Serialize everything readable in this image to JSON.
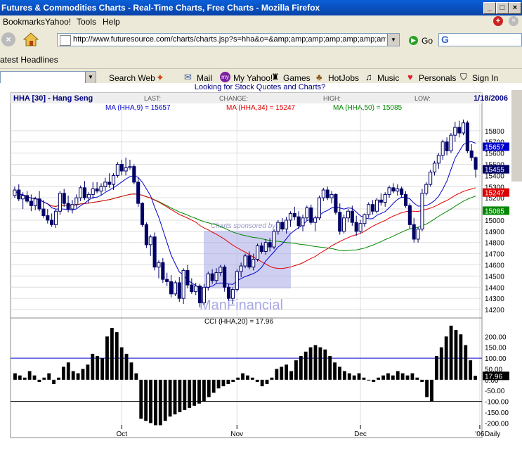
{
  "window": {
    "title": "Futures & Commodities Charts - Real-Time Charts, Free Charts - Mozilla Firefox"
  },
  "menu": [
    "Bookmarks",
    "Yahoo!",
    "Tools",
    "Help"
  ],
  "nav": {
    "url": "http://www.futuresource.com/charts/charts.jsp?s=hha&o=&amp;amp;amp;amp;amp;amp;amp;amp;a=",
    "go_label": "Go"
  },
  "headlines_label": "atest Headlines",
  "yahoo_toolbar": {
    "items": [
      "Search Web",
      "Mail",
      "My Yahoo!",
      "Games",
      "HotJobs",
      "Music",
      "Personals",
      "Sign In"
    ]
  },
  "page": {
    "looking_for": "Looking for Stock Quotes and Charts?"
  },
  "chart_data": {
    "type": "candlestick",
    "title": "HHA [30] - Hang Seng",
    "date": "1/18/2006",
    "header_fields": [
      "LAST:",
      "CHANGE:",
      "HIGH:",
      "LOW:"
    ],
    "ma_labels": [
      {
        "text": "MA (HHA,9) = 15657",
        "color": "#0000cc",
        "value": 15657
      },
      {
        "text": "MA (HHA,34) = 15247",
        "color": "#dd0000",
        "value": 15247
      },
      {
        "text": "MA (HHA,50) = 15085",
        "color": "#008800",
        "value": 15085
      }
    ],
    "last_price": 15455,
    "ylim": [
      14150,
      15950
    ],
    "y_ticks": [
      15800,
      15700,
      15600,
      15500,
      15400,
      15300,
      15200,
      15100,
      15000,
      14900,
      14800,
      14700,
      14600,
      14500,
      14400,
      14300,
      14200
    ],
    "x_ticks": [
      {
        "label": "Oct",
        "index": 26
      },
      {
        "label": "Nov",
        "index": 54
      },
      {
        "label": "Dec",
        "index": 84
      },
      {
        "label": "'06",
        "index": 113
      }
    ],
    "watermark": {
      "sponsor": "Charts sponsored by:",
      "brand": "ManFinancial"
    },
    "candles": [
      [
        15220,
        15300,
        15200,
        15270
      ],
      [
        15270,
        15320,
        15170,
        15190
      ],
      [
        15190,
        15250,
        15100,
        15220
      ],
      [
        15220,
        15260,
        15150,
        15170
      ],
      [
        15170,
        15230,
        15080,
        15130
      ],
      [
        15130,
        15210,
        15090,
        15190
      ],
      [
        15190,
        15260,
        15080,
        15100
      ],
      [
        15100,
        15180,
        15020,
        15040
      ],
      [
        15040,
        15100,
        14970,
        15000
      ],
      [
        15000,
        15060,
        14940,
        14960
      ],
      [
        14960,
        15100,
        14930,
        15080
      ],
      [
        15080,
        15260,
        15050,
        15240
      ],
      [
        15240,
        15280,
        15120,
        15150
      ],
      [
        15150,
        15220,
        15070,
        15100
      ],
      [
        15100,
        15180,
        15060,
        15140
      ],
      [
        15140,
        15230,
        15110,
        15200
      ],
      [
        15200,
        15310,
        15170,
        15290
      ],
      [
        15290,
        15350,
        15180,
        15200
      ],
      [
        15200,
        15250,
        15150,
        15230
      ],
      [
        15230,
        15340,
        15190,
        15280
      ],
      [
        15280,
        15340,
        15240,
        15260
      ],
      [
        15260,
        15330,
        15220,
        15300
      ],
      [
        15300,
        15380,
        15260,
        15340
      ],
      [
        15340,
        15420,
        15290,
        15320
      ],
      [
        15320,
        15420,
        15270,
        15400
      ],
      [
        15400,
        15520,
        15380,
        15500
      ],
      [
        15500,
        15540,
        15400,
        15440
      ],
      [
        15440,
        15560,
        15400,
        15470
      ],
      [
        15470,
        15540,
        15450,
        15480
      ],
      [
        15480,
        15500,
        15320,
        15340
      ],
      [
        15340,
        15380,
        15120,
        15150
      ],
      [
        15150,
        15160,
        14940,
        14960
      ],
      [
        14960,
        14980,
        14750,
        14780
      ],
      [
        14780,
        14870,
        14680,
        14850
      ],
      [
        14850,
        14890,
        14550,
        14580
      ],
      [
        14580,
        14640,
        14480,
        14620
      ],
      [
        14620,
        14660,
        14440,
        14470
      ],
      [
        14470,
        14530,
        14410,
        14450
      ],
      [
        14450,
        14510,
        14310,
        14340
      ],
      [
        14340,
        14460,
        14320,
        14440
      ],
      [
        14440,
        14490,
        14270,
        14300
      ],
      [
        14300,
        14570,
        14250,
        14550
      ],
      [
        14550,
        14600,
        14390,
        14420
      ],
      [
        14420,
        14480,
        14340,
        14360
      ],
      [
        14360,
        14440,
        14330,
        14410
      ],
      [
        14410,
        14430,
        14220,
        14260
      ],
      [
        14260,
        14430,
        14240,
        14400
      ],
      [
        14400,
        14540,
        14370,
        14520
      ],
      [
        14520,
        14560,
        14430,
        14460
      ],
      [
        14460,
        14570,
        14430,
        14530
      ],
      [
        14530,
        14600,
        14500,
        14580
      ],
      [
        14580,
        14600,
        14360,
        14400
      ],
      [
        14400,
        14430,
        14280,
        14300
      ],
      [
        14300,
        14400,
        14250,
        14380
      ],
      [
        14380,
        14560,
        14360,
        14540
      ],
      [
        14540,
        14620,
        14490,
        14590
      ],
      [
        14590,
        14700,
        14570,
        14680
      ],
      [
        14680,
        14720,
        14560,
        14580
      ],
      [
        14580,
        14700,
        14550,
        14650
      ],
      [
        14650,
        14790,
        14630,
        14770
      ],
      [
        14770,
        14800,
        14700,
        14720
      ],
      [
        14720,
        14830,
        14690,
        14800
      ],
      [
        14800,
        14840,
        14720,
        14760
      ],
      [
        14760,
        14920,
        14740,
        14900
      ],
      [
        14900,
        15000,
        14870,
        14980
      ],
      [
        14980,
        15020,
        14900,
        14920
      ],
      [
        14920,
        15030,
        14880,
        15000
      ],
      [
        15000,
        15080,
        14940,
        15060
      ],
      [
        15060,
        15120,
        15000,
        15030
      ],
      [
        15030,
        15080,
        14920,
        14950
      ],
      [
        14950,
        15050,
        14900,
        15020
      ],
      [
        15020,
        15130,
        15000,
        15110
      ],
      [
        15110,
        15140,
        14960,
        14980
      ],
      [
        14980,
        15040,
        14900,
        15020
      ],
      [
        15020,
        15220,
        15000,
        15200
      ],
      [
        15200,
        15290,
        15170,
        15270
      ],
      [
        15270,
        15300,
        15180,
        15200
      ],
      [
        15200,
        15260,
        15150,
        15230
      ],
      [
        15230,
        15240,
        15050,
        15070
      ],
      [
        15070,
        15150,
        14870,
        14900
      ],
      [
        14900,
        15050,
        14880,
        15020
      ],
      [
        15020,
        15100,
        14980,
        15080
      ],
      [
        15080,
        15130,
        14950,
        14980
      ],
      [
        14980,
        15040,
        14860,
        14900
      ],
      [
        14900,
        15000,
        14880,
        14970
      ],
      [
        14970,
        15060,
        14940,
        15050
      ],
      [
        15050,
        15160,
        15020,
        15140
      ],
      [
        15140,
        15180,
        15050,
        15080
      ],
      [
        15080,
        15200,
        15060,
        15180
      ],
      [
        15180,
        15240,
        15130,
        15160
      ],
      [
        15160,
        15250,
        15120,
        15230
      ],
      [
        15230,
        15310,
        15200,
        15290
      ],
      [
        15290,
        15330,
        15240,
        15260
      ],
      [
        15260,
        15320,
        15220,
        15280
      ],
      [
        15280,
        15300,
        15200,
        15230
      ],
      [
        15230,
        15260,
        15110,
        15130
      ],
      [
        15130,
        15150,
        14920,
        14960
      ],
      [
        14960,
        15020,
        14800,
        14830
      ],
      [
        14830,
        14940,
        14800,
        14920
      ],
      [
        14920,
        15280,
        14900,
        15240
      ],
      [
        15240,
        15340,
        15220,
        15320
      ],
      [
        15320,
        15450,
        15300,
        15430
      ],
      [
        15430,
        15530,
        15400,
        15510
      ],
      [
        15510,
        15600,
        15460,
        15580
      ],
      [
        15580,
        15720,
        15540,
        15700
      ],
      [
        15700,
        15740,
        15580,
        15620
      ],
      [
        15620,
        15780,
        15600,
        15760
      ],
      [
        15760,
        15880,
        15700,
        15830
      ],
      [
        15830,
        15890,
        15740,
        15780
      ],
      [
        15780,
        15900,
        15760,
        15870
      ],
      [
        15870,
        15890,
        15600,
        15620
      ],
      [
        15620,
        15680,
        15530,
        15560
      ],
      [
        15560,
        15570,
        15380,
        15455
      ]
    ],
    "cci": {
      "label": "CCI (HHA,20) = 17.96",
      "value": 17.96,
      "ylim": [
        -215,
        240
      ],
      "y_ticks": [
        200,
        150,
        100,
        50,
        0,
        -50,
        -100,
        -150,
        -200
      ],
      "ref_lines": [
        {
          "value": 100,
          "color": "#0000cc"
        },
        {
          "value": -100,
          "color": "#000000"
        }
      ],
      "values": [
        30,
        20,
        10,
        40,
        20,
        -10,
        10,
        30,
        -20,
        10,
        60,
        80,
        40,
        30,
        50,
        70,
        120,
        110,
        100,
        200,
        240,
        220,
        150,
        120,
        80,
        30,
        -180,
        -190,
        -200,
        -210,
        -210,
        -190,
        -170,
        -160,
        -150,
        -140,
        -130,
        -120,
        -110,
        -100,
        -80,
        -60,
        -40,
        -30,
        -20,
        -10,
        10,
        30,
        20,
        10,
        -10,
        -30,
        -20,
        10,
        50,
        60,
        70,
        40,
        90,
        110,
        130,
        150,
        160,
        150,
        140,
        110,
        80,
        60,
        40,
        30,
        20,
        30,
        10,
        0,
        -10,
        10,
        20,
        30,
        20,
        40,
        30,
        20,
        30,
        10,
        -10,
        -80,
        -100,
        110,
        150,
        200,
        250,
        230,
        210,
        160,
        90,
        18
      ]
    }
  }
}
